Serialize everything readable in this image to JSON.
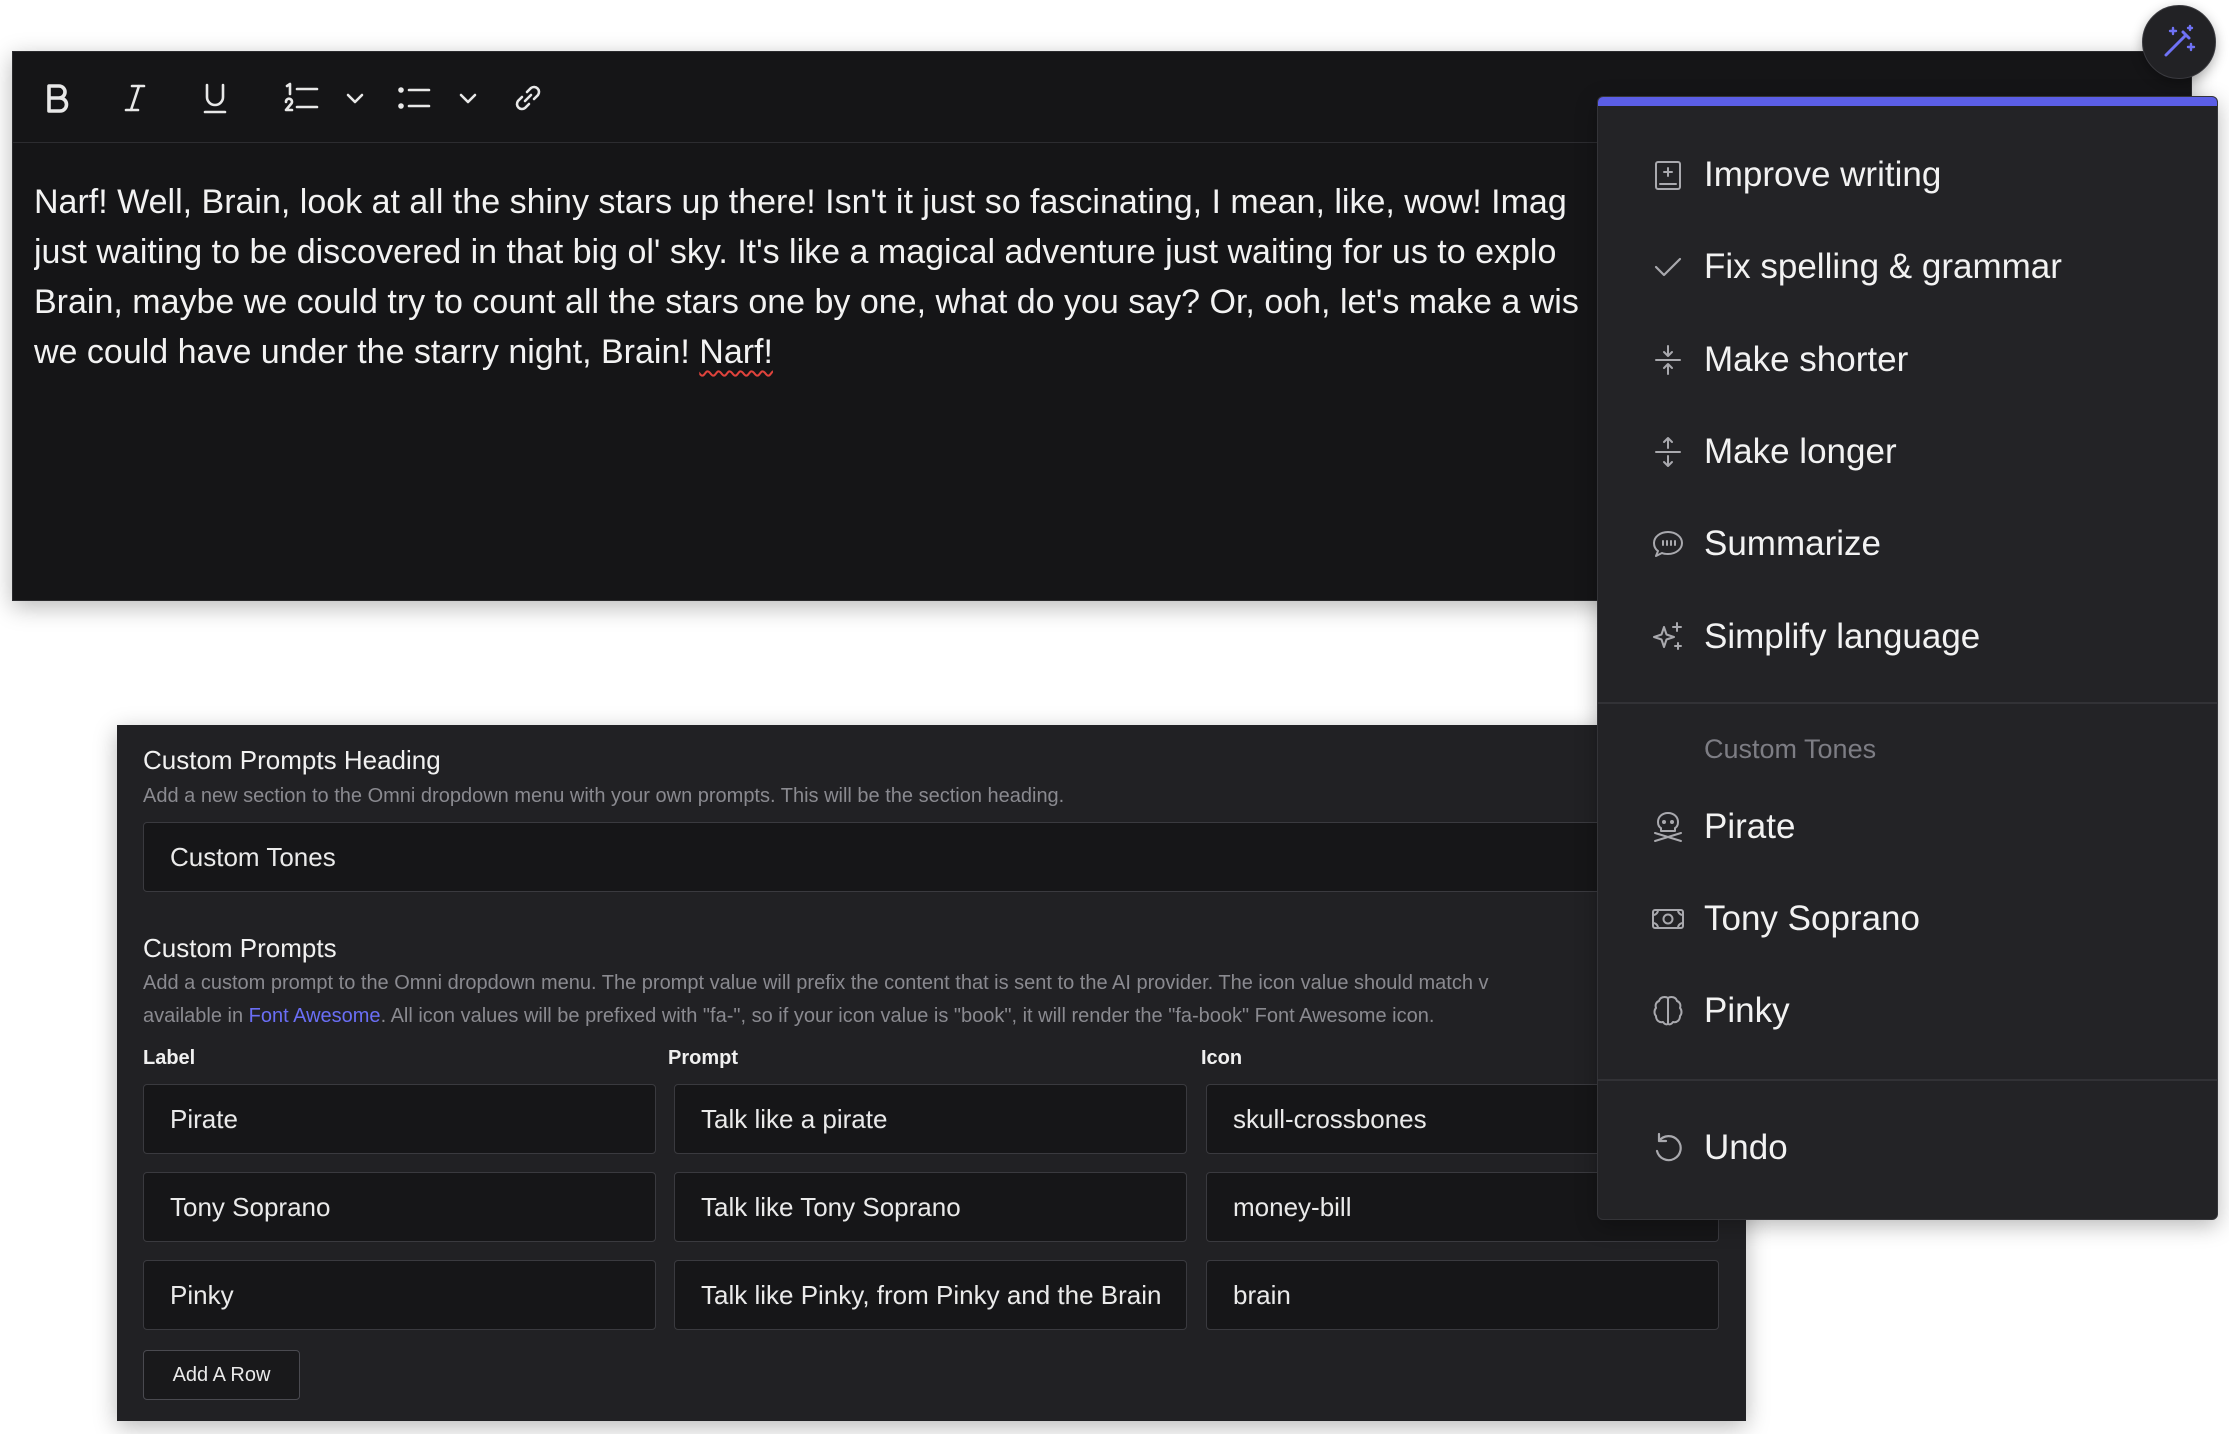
{
  "editor": {
    "lines": [
      "Narf! Well, Brain, look at all the shiny stars up there! Isn't it just so fascinating, I mean, like, wow! Imag",
      "just waiting to be discovered in that big ol' sky. It's like a magical adventure just waiting for us to explo",
      "Brain, maybe we could try to count all the stars one by one, what do you say? Or, ooh, let's make a wis",
      "we could have under the starry night, Brain! "
    ],
    "misspelled_word": "Narf!",
    "toolbar_icons": [
      "bold-icon",
      "italic-icon",
      "underline-icon",
      "numbered-list-icon",
      "bullet-list-icon",
      "link-icon"
    ]
  },
  "settings": {
    "heading_title": "Custom Prompts Heading",
    "heading_desc": "Add a new section to the Omni dropdown menu with your own prompts. This will be the section heading.",
    "heading_value": "Custom Tones",
    "prompts_title": "Custom Prompts",
    "prompts_desc_1": "Add a custom prompt to the Omni dropdown menu. The prompt value will prefix the content that is sent to the AI provider. The icon value should match v",
    "prompts_desc_2a": "available in ",
    "prompts_desc_link": "Font Awesome",
    "prompts_desc_2b": ". All icon values will be prefixed with \"fa-\", so if your icon value is \"book\", it will render the \"fa-book\" Font Awesome icon.",
    "columns": {
      "label": "Label",
      "prompt": "Prompt",
      "icon": "Icon"
    },
    "rows": [
      {
        "label": "Pirate",
        "prompt": "Talk like a pirate",
        "icon": "skull-crossbones"
      },
      {
        "label": "Tony Soprano",
        "prompt": "Talk like Tony Soprano",
        "icon": "money-bill"
      },
      {
        "label": "Pinky",
        "prompt": "Talk like Pinky, from Pinky and the Brain",
        "icon": "brain"
      }
    ],
    "add_row_label": "Add A Row"
  },
  "omni_menu": {
    "accent_color": "#5b5ee6",
    "items": [
      {
        "label": "Improve writing",
        "icon": "improve-writing-icon"
      },
      {
        "label": "Fix spelling & grammar",
        "icon": "check-icon"
      },
      {
        "label": "Make shorter",
        "icon": "compress-icon"
      },
      {
        "label": "Make longer",
        "icon": "expand-icon"
      },
      {
        "label": "Summarize",
        "icon": "quote-bubble-icon"
      },
      {
        "label": "Simplify language",
        "icon": "sparkles-icon"
      }
    ],
    "custom_section_title": "Custom Tones",
    "custom_items": [
      {
        "label": "Pirate",
        "icon": "skull-crossbones-icon"
      },
      {
        "label": "Tony Soprano",
        "icon": "money-bill-icon"
      },
      {
        "label": "Pinky",
        "icon": "brain-icon"
      }
    ],
    "undo_label": "Undo"
  }
}
